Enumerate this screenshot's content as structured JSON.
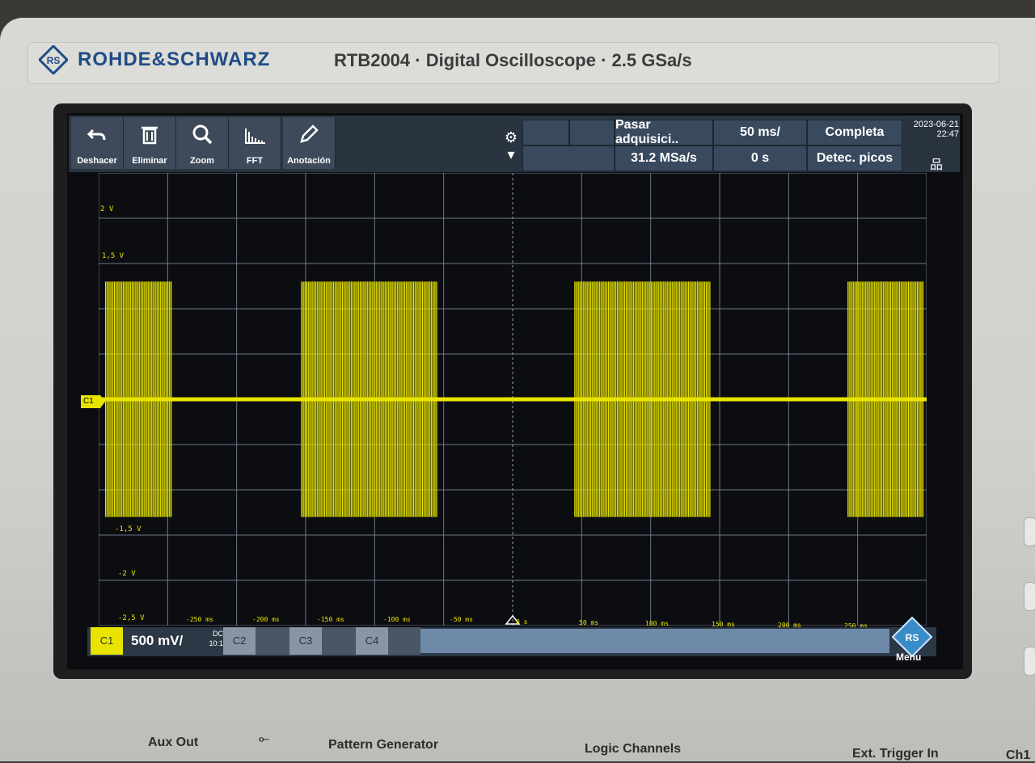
{
  "brand": "ROHDE&SCHWARZ",
  "model": "RTB2004 · Digital Oscilloscope · 2.5 GSa/s",
  "toolbar": {
    "buttons": [
      {
        "label": "Deshacer",
        "icon": "undo-icon"
      },
      {
        "label": "Eliminar",
        "icon": "trash-icon"
      },
      {
        "label": "Zoom",
        "icon": "zoom-icon"
      },
      {
        "label": "FFT",
        "icon": "fft-icon"
      },
      {
        "label": "Anotación",
        "icon": "pencil-icon"
      }
    ]
  },
  "acquisition": {
    "mode": "Pasar adquisici..",
    "sample_rate": "31.2 MSa/s",
    "timebase": "50 ms/",
    "offset": "0 s",
    "status": "Completa",
    "detect": "Detec. picos",
    "date": "2023-06-21",
    "time": "22:47"
  },
  "y_labels": [
    "2 V",
    "1,5 V",
    "",
    "",
    "",
    "",
    "",
    "-1,5 V",
    "-2 V",
    "-2,5 V"
  ],
  "x_labels": [
    "-250 ms",
    "-200 ms",
    "-150 ms",
    "-100 ms",
    "-50 ms",
    "0 s",
    "50 ms",
    "100 ms",
    "150 ms",
    "200 ms",
    "250 ms"
  ],
  "channel_marker": "C1",
  "channels": {
    "c1": "C1",
    "c1_scale": "500 mV/",
    "c1_coupling": "DC",
    "c1_probe": "10:1",
    "c2": "C2",
    "c3": "C3",
    "c4": "C4"
  },
  "menu_label": "Menu",
  "panel": {
    "aux_out": "Aux Out",
    "pattern": "Pattern Generator",
    "logic": "Logic Channels",
    "ext_trigger": "Ext. Trigger In",
    "ch1": "Ch1"
  },
  "colors": {
    "trace": "#e8e400",
    "grid": "#8e9ab0",
    "toolbar": "#2a3441",
    "accent": "#1e4c86"
  },
  "chart_data": {
    "type": "line",
    "title": "",
    "xlabel": "",
    "ylabel": "",
    "xlim": [
      -300,
      300
    ],
    "ylim": [
      -2.5,
      2.5
    ],
    "bursts": [
      {
        "start": -295,
        "end": -247,
        "amp_high": 1.3,
        "amp_low": -1.3
      },
      {
        "start": -153,
        "end": -55,
        "amp_high": 1.3,
        "amp_low": -1.3
      },
      {
        "start": 45,
        "end": 143,
        "amp_high": 1.3,
        "amp_low": -1.3
      },
      {
        "start": 243,
        "end": 298,
        "amp_high": 1.3,
        "amp_low": -1.3
      }
    ],
    "baseline": 0.0,
    "grid": true
  }
}
